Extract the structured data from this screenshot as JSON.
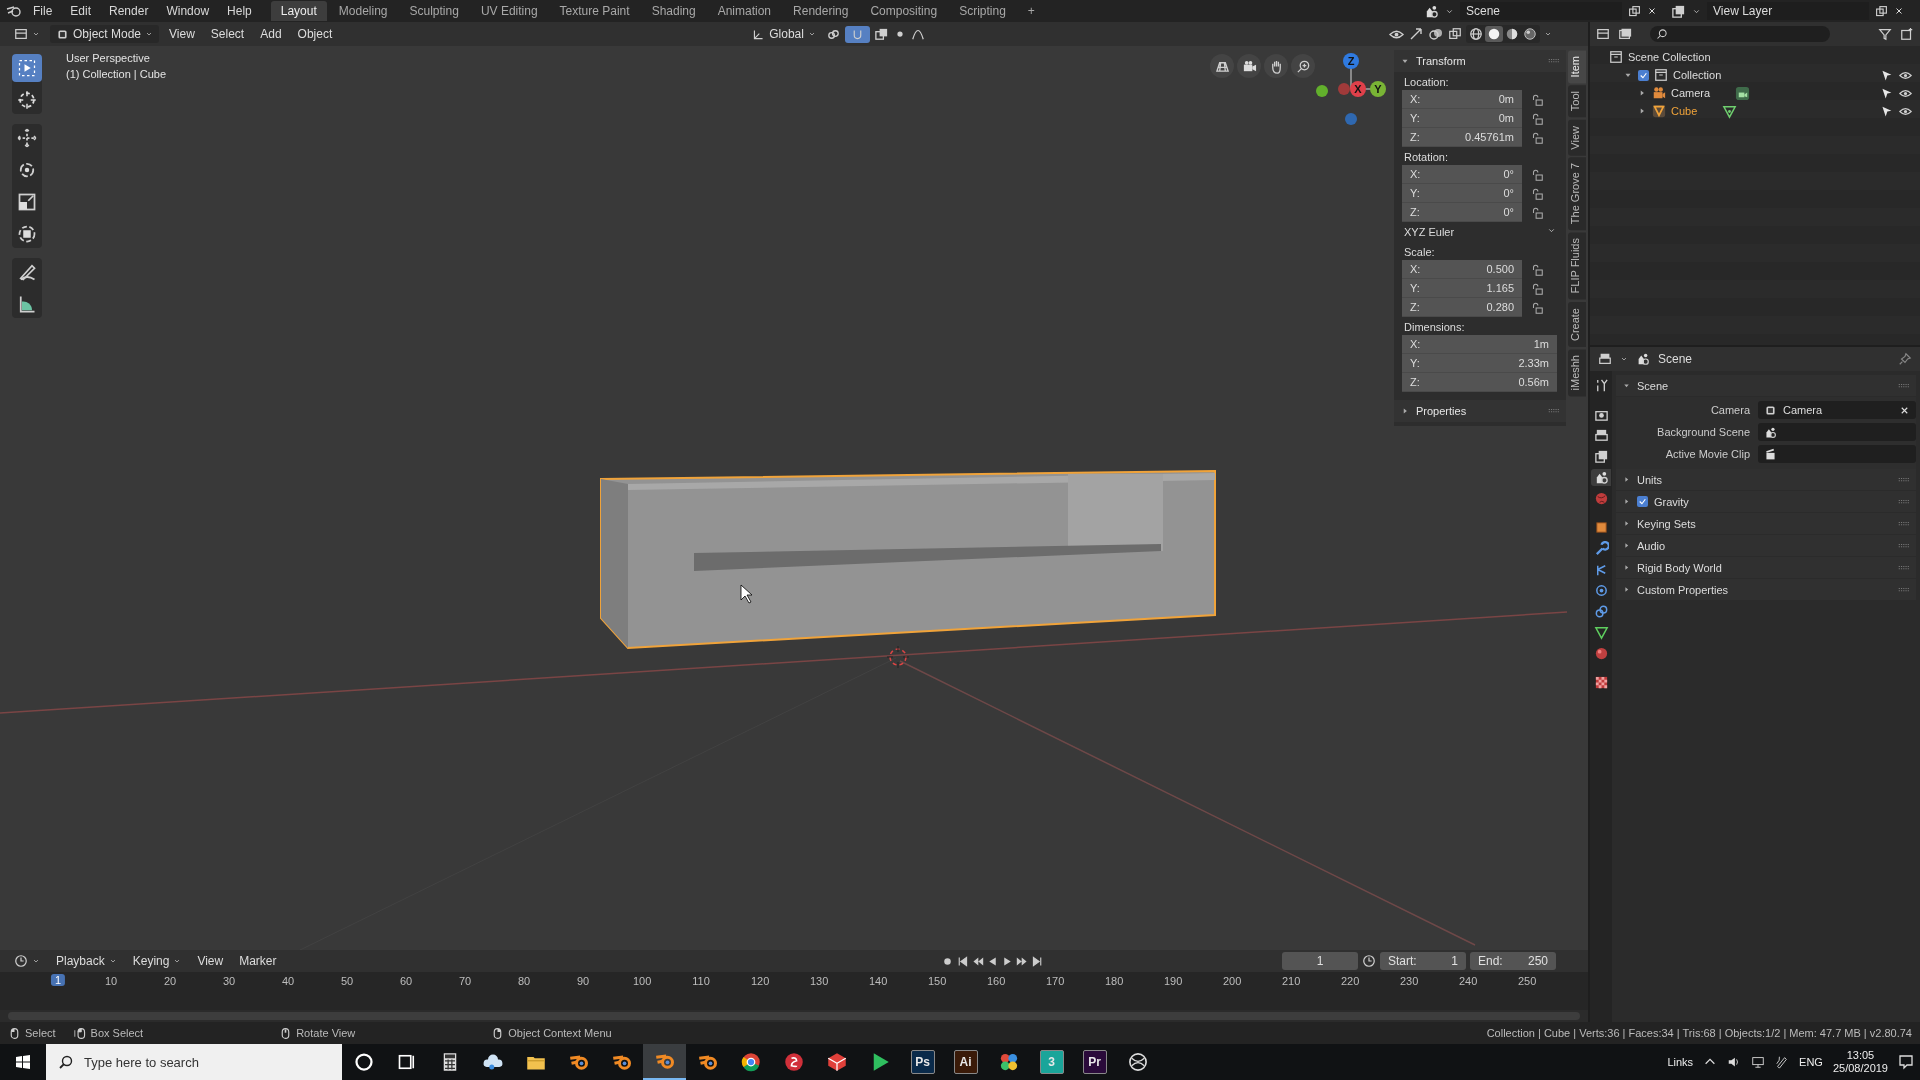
{
  "top_bar": {
    "menus": [
      "File",
      "Edit",
      "Render",
      "Window",
      "Help"
    ],
    "workspaces": [
      {
        "label": "Layout",
        "selected": true
      },
      {
        "label": "Modeling",
        "selected": false
      },
      {
        "label": "Sculpting",
        "selected": false
      },
      {
        "label": "UV Editing",
        "selected": false
      },
      {
        "label": "Texture Paint",
        "selected": false
      },
      {
        "label": "Shading",
        "selected": false
      },
      {
        "label": "Animation",
        "selected": false
      },
      {
        "label": "Rendering",
        "selected": false
      },
      {
        "label": "Compositing",
        "selected": false
      },
      {
        "label": "Scripting",
        "selected": false
      }
    ],
    "add_workspace": "+",
    "scene": "Scene",
    "view_layer": "View Layer"
  },
  "viewport_header": {
    "mode": "Object Mode",
    "menus": [
      "View",
      "Select",
      "Add",
      "Object"
    ],
    "orientation": "Global",
    "snap_on": true,
    "shading": [
      {
        "kind": "wireframe",
        "selected": false
      },
      {
        "kind": "solid",
        "selected": true
      },
      {
        "kind": "material",
        "selected": false
      },
      {
        "kind": "rendered",
        "selected": false
      }
    ]
  },
  "toolbar": {
    "groups": [
      {
        "tools": [
          {
            "kind": "select_box",
            "selected": true
          },
          {
            "kind": "cursor",
            "selected": false
          }
        ]
      },
      {
        "tools": [
          {
            "kind": "move",
            "selected": false
          },
          {
            "kind": "rotate",
            "selected": false
          },
          {
            "kind": "scale",
            "selected": false
          },
          {
            "kind": "transform",
            "selected": false
          }
        ]
      },
      {
        "tools": [
          {
            "kind": "annotate",
            "selected": false
          },
          {
            "kind": "measure",
            "selected": false
          }
        ]
      }
    ]
  },
  "viewport": {
    "view_name": "User Perspective",
    "context": "(1) Collection | Cube",
    "gizmo": [
      {
        "axis": "Z"
      },
      {
        "axis": "X"
      },
      {
        "axis": "Y"
      }
    ]
  },
  "sidebar": {
    "tabs": [
      {
        "label": "Item",
        "selected": true
      },
      {
        "label": "Tool",
        "selected": false
      },
      {
        "label": "View",
        "selected": false
      },
      {
        "label": "The Grove 7",
        "selected": false
      },
      {
        "label": "FLIP Fluids",
        "selected": false
      },
      {
        "label": "Create",
        "selected": false
      },
      {
        "label": "iMeshh",
        "selected": false
      }
    ],
    "transform": {
      "title": "Transform",
      "expanded": true,
      "groups": [
        {
          "label": "Location:",
          "fields": [
            {
              "axis": "X:",
              "value": "0m",
              "locked": false
            },
            {
              "axis": "Y:",
              "value": "0m",
              "locked": false
            },
            {
              "axis": "Z:",
              "value": "0.45761m",
              "locked": false
            }
          ]
        },
        {
          "label": "Rotation:",
          "fields": [
            {
              "axis": "X:",
              "value": "0°",
              "locked": false
            },
            {
              "axis": "Y:",
              "value": "0°",
              "locked": false
            },
            {
              "axis": "Z:",
              "value": "0°",
              "locked": false
            }
          ],
          "mode": "XYZ Euler"
        },
        {
          "label": "Scale:",
          "fields": [
            {
              "axis": "X:",
              "value": "0.500",
              "locked": false
            },
            {
              "axis": "Y:",
              "value": "1.165",
              "locked": false
            },
            {
              "axis": "Z:",
              "value": "0.280",
              "locked": false
            }
          ]
        },
        {
          "label": "Dimensions:",
          "fields": [
            {
              "axis": "X:",
              "value": "1m"
            },
            {
              "axis": "Y:",
              "value": "2.33m"
            },
            {
              "axis": "Z:",
              "value": "0.56m"
            }
          ]
        }
      ]
    },
    "properties": {
      "title": "Properties",
      "expanded": false
    }
  },
  "outliner": {
    "tree": [
      {
        "label": "Scene Collection",
        "kind": "scene_collection",
        "selected": false,
        "children": [
          {
            "label": "Collection",
            "kind": "collection",
            "selected": false,
            "checked": true,
            "expanded": true,
            "children": [
              {
                "label": "Camera",
                "kind": "camera",
                "selected": false,
                "expanded": false
              },
              {
                "label": "Cube",
                "kind": "mesh",
                "selected": true,
                "expanded": false
              }
            ]
          }
        ]
      }
    ]
  },
  "properties_editor": {
    "context": "Scene",
    "tabs": [
      {
        "kind": "tool",
        "selected": false
      },
      {
        "kind": "render",
        "selected": false
      },
      {
        "kind": "output",
        "selected": false
      },
      {
        "kind": "view_layer",
        "selected": false
      },
      {
        "kind": "scene",
        "selected": true
      },
      {
        "kind": "world",
        "selected": false
      },
      {
        "kind": "object",
        "selected": false
      },
      {
        "kind": "modifiers",
        "selected": false
      },
      {
        "kind": "particles",
        "selected": false
      },
      {
        "kind": "physics",
        "selected": false
      },
      {
        "kind": "constraints",
        "selected": false
      },
      {
        "kind": "data",
        "selected": false
      },
      {
        "kind": "material",
        "selected": false
      },
      {
        "kind": "texture",
        "selected": false
      }
    ],
    "panels": [
      {
        "title": "Scene",
        "expanded": true,
        "fields": [
          {
            "label": "Camera",
            "kind": "object",
            "value": "Camera"
          },
          {
            "label": "Background Scene",
            "kind": "scene"
          },
          {
            "label": "Active Movie Clip",
            "kind": "clip"
          }
        ]
      },
      {
        "title": "Units",
        "expanded": false
      },
      {
        "title": "Gravity",
        "expanded": false,
        "checked": true
      },
      {
        "title": "Keying Sets",
        "expanded": false
      },
      {
        "title": "Audio",
        "expanded": false
      },
      {
        "title": "Rigid Body World",
        "expanded": false
      },
      {
        "title": "Custom Properties",
        "expanded": false
      }
    ]
  },
  "timeline": {
    "menus": [
      "Playback",
      "Keying",
      "View",
      "Marker"
    ],
    "current_frame": "1",
    "start_label": "Start:",
    "start": "1",
    "end_label": "End:",
    "end": "250",
    "ruler": {
      "current": "1",
      "labels": [
        "10",
        "20",
        "30",
        "40",
        "50",
        "60",
        "70",
        "80",
        "90",
        "100",
        "110",
        "120",
        "130",
        "140",
        "150",
        "160",
        "170",
        "180",
        "190",
        "200",
        "210",
        "220",
        "230",
        "240",
        "250"
      ]
    }
  },
  "status_bar": {
    "hints": [
      {
        "kind": "mouse_left",
        "label": "Select"
      },
      {
        "kind": "mouse_drag",
        "label": "Box Select"
      },
      {
        "kind": "mouse_middle",
        "label": "Rotate View"
      },
      {
        "kind": "mouse_right",
        "label": "Object Context Menu"
      }
    ],
    "stats": "Collection | Cube | Verts:36 | Faces:34 | Tris:68 | Objects:1/2 | Mem: 47.7 MB | v2.80.74"
  },
  "taskbar": {
    "search_placeholder": "Type here to search",
    "apps": [
      {
        "kind": "cortana",
        "active": false
      },
      {
        "kind": "task_view",
        "active": false
      },
      {
        "kind": "calculator",
        "active": false
      },
      {
        "kind": "cloud",
        "active": false
      },
      {
        "kind": "folder",
        "active": false
      },
      {
        "kind": "blender",
        "active": false
      },
      {
        "kind": "blender",
        "active": false
      },
      {
        "kind": "blender",
        "active": true
      },
      {
        "kind": "blender",
        "active": false
      },
      {
        "kind": "chrome",
        "active": false
      },
      {
        "kind": "red_circle",
        "active": false
      },
      {
        "kind": "red_cube",
        "active": false
      },
      {
        "kind": "play",
        "active": false
      },
      {
        "kind": "tile",
        "label": "Ps",
        "color": "#0a2a4a",
        "active": false
      },
      {
        "kind": "tile",
        "label": "Ai",
        "color": "#3a1a08",
        "active": false
      },
      {
        "kind": "flower",
        "active": false
      },
      {
        "kind": "tile",
        "label": "3",
        "color": "#1aa59a",
        "active": false
      },
      {
        "kind": "tile",
        "label": "Pr",
        "color": "#2a0a3a",
        "active": false
      },
      {
        "kind": "ring",
        "active": false
      }
    ],
    "toolbar_label": "Links",
    "language": "ENG",
    "time": "13:05",
    "date": "25/08/2019"
  }
}
